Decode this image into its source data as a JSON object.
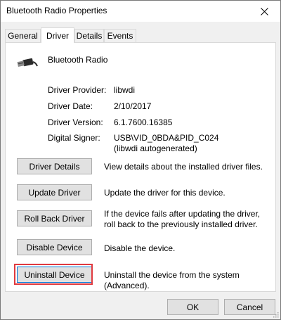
{
  "window": {
    "title": "Bluetooth Radio  Properties",
    "close_glyph": "✕"
  },
  "tabs": [
    {
      "label": "General",
      "active": false
    },
    {
      "label": "Driver",
      "active": true
    },
    {
      "label": "Details",
      "active": false
    },
    {
      "label": "Events",
      "active": false
    }
  ],
  "device": {
    "name": "Bluetooth Radio",
    "icon": "usb-plug-icon"
  },
  "info": [
    {
      "label": "Driver Provider:",
      "value": "libwdi"
    },
    {
      "label": "Driver Date:",
      "value": "2/10/2017"
    },
    {
      "label": "Driver Version:",
      "value": "6.1.7600.16385"
    },
    {
      "label": "Digital Signer:",
      "value": "USB\\VID_0BDA&PID_C024 (libwdi autogenerated)"
    }
  ],
  "actions": [
    {
      "label": "Driver Details",
      "desc": "View details about the installed driver files."
    },
    {
      "label": "Update Driver",
      "desc": "Update the driver for this device."
    },
    {
      "label": "Roll Back Driver",
      "desc": "If the device fails after updating the driver, roll back to the previously installed driver."
    },
    {
      "label": "Disable Device",
      "desc": "Disable the device."
    },
    {
      "label": "Uninstall Device",
      "desc": "Uninstall the device from the system (Advanced)."
    }
  ],
  "footer": {
    "ok_label": "OK",
    "cancel_label": "Cancel"
  },
  "colors": {
    "highlight": "#e0393e",
    "focus": "#0078d7"
  }
}
